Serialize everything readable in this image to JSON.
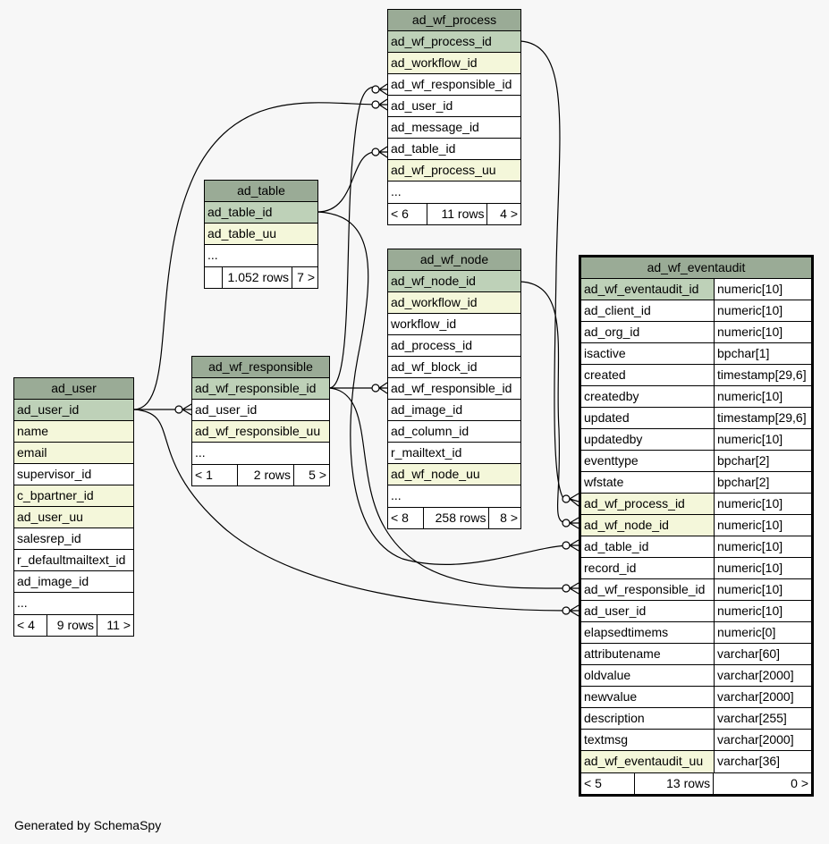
{
  "footer": {
    "generated": "Generated by SchemaSpy"
  },
  "tables": {
    "ad_wf_process": {
      "name": "ad_wf_process",
      "columns": [
        {
          "name": "ad_wf_process_id",
          "kind": "pk"
        },
        {
          "name": "ad_workflow_id",
          "kind": "idx"
        },
        {
          "name": "ad_wf_responsible_id",
          "kind": ""
        },
        {
          "name": "ad_user_id",
          "kind": ""
        },
        {
          "name": "ad_message_id",
          "kind": ""
        },
        {
          "name": "ad_table_id",
          "kind": ""
        },
        {
          "name": "ad_wf_process_uu",
          "kind": "idx"
        },
        {
          "name": "...",
          "kind": ""
        }
      ],
      "footer": [
        "< 6",
        "11 rows",
        "4 >"
      ]
    },
    "ad_table": {
      "name": "ad_table",
      "columns": [
        {
          "name": "ad_table_id",
          "kind": "pk"
        },
        {
          "name": "ad_table_uu",
          "kind": "idx"
        },
        {
          "name": "...",
          "kind": ""
        }
      ],
      "footer": [
        "",
        "1.052 rows",
        "7 >"
      ]
    },
    "ad_wf_node": {
      "name": "ad_wf_node",
      "columns": [
        {
          "name": "ad_wf_node_id",
          "kind": "pk"
        },
        {
          "name": "ad_workflow_id",
          "kind": "idx"
        },
        {
          "name": "workflow_id",
          "kind": ""
        },
        {
          "name": "ad_process_id",
          "kind": ""
        },
        {
          "name": "ad_wf_block_id",
          "kind": ""
        },
        {
          "name": "ad_wf_responsible_id",
          "kind": ""
        },
        {
          "name": "ad_image_id",
          "kind": ""
        },
        {
          "name": "ad_column_id",
          "kind": ""
        },
        {
          "name": "r_mailtext_id",
          "kind": ""
        },
        {
          "name": "ad_wf_node_uu",
          "kind": "idx"
        },
        {
          "name": "...",
          "kind": ""
        }
      ],
      "footer": [
        "< 8",
        "258 rows",
        "8 >"
      ]
    },
    "ad_wf_responsible": {
      "name": "ad_wf_responsible",
      "columns": [
        {
          "name": "ad_wf_responsible_id",
          "kind": "pk"
        },
        {
          "name": "ad_user_id",
          "kind": ""
        },
        {
          "name": "ad_wf_responsible_uu",
          "kind": "idx"
        },
        {
          "name": "...",
          "kind": ""
        }
      ],
      "footer": [
        "< 1",
        "2 rows",
        "5 >"
      ]
    },
    "ad_user": {
      "name": "ad_user",
      "columns": [
        {
          "name": "ad_user_id",
          "kind": "pk"
        },
        {
          "name": "name",
          "kind": "idx"
        },
        {
          "name": "email",
          "kind": "idx"
        },
        {
          "name": "supervisor_id",
          "kind": ""
        },
        {
          "name": "c_bpartner_id",
          "kind": "idx"
        },
        {
          "name": "ad_user_uu",
          "kind": "idx"
        },
        {
          "name": "salesrep_id",
          "kind": ""
        },
        {
          "name": "r_defaultmailtext_id",
          "kind": ""
        },
        {
          "name": "ad_image_id",
          "kind": ""
        },
        {
          "name": "...",
          "kind": ""
        }
      ],
      "footer": [
        "< 4",
        "9 rows",
        "11 >"
      ]
    },
    "ad_wf_eventaudit": {
      "name": "ad_wf_eventaudit",
      "columns": [
        {
          "name": "ad_wf_eventaudit_id",
          "type": "numeric[10]",
          "kind": "pk"
        },
        {
          "name": "ad_client_id",
          "type": "numeric[10]",
          "kind": ""
        },
        {
          "name": "ad_org_id",
          "type": "numeric[10]",
          "kind": ""
        },
        {
          "name": "isactive",
          "type": "bpchar[1]",
          "kind": ""
        },
        {
          "name": "created",
          "type": "timestamp[29,6]",
          "kind": ""
        },
        {
          "name": "createdby",
          "type": "numeric[10]",
          "kind": ""
        },
        {
          "name": "updated",
          "type": "timestamp[29,6]",
          "kind": ""
        },
        {
          "name": "updatedby",
          "type": "numeric[10]",
          "kind": ""
        },
        {
          "name": "eventtype",
          "type": "bpchar[2]",
          "kind": ""
        },
        {
          "name": "wfstate",
          "type": "bpchar[2]",
          "kind": ""
        },
        {
          "name": "ad_wf_process_id",
          "type": "numeric[10]",
          "kind": "idx"
        },
        {
          "name": "ad_wf_node_id",
          "type": "numeric[10]",
          "kind": "idx"
        },
        {
          "name": "ad_table_id",
          "type": "numeric[10]",
          "kind": ""
        },
        {
          "name": "record_id",
          "type": "numeric[10]",
          "kind": ""
        },
        {
          "name": "ad_wf_responsible_id",
          "type": "numeric[10]",
          "kind": ""
        },
        {
          "name": "ad_user_id",
          "type": "numeric[10]",
          "kind": ""
        },
        {
          "name": "elapsedtimems",
          "type": "numeric[0]",
          "kind": ""
        },
        {
          "name": "attributename",
          "type": "varchar[60]",
          "kind": ""
        },
        {
          "name": "oldvalue",
          "type": "varchar[2000]",
          "kind": ""
        },
        {
          "name": "newvalue",
          "type": "varchar[2000]",
          "kind": ""
        },
        {
          "name": "description",
          "type": "varchar[255]",
          "kind": ""
        },
        {
          "name": "textmsg",
          "type": "varchar[2000]",
          "kind": ""
        },
        {
          "name": "ad_wf_eventaudit_uu",
          "type": "varchar[36]",
          "kind": "idx"
        }
      ],
      "footer": [
        "< 5",
        "13 rows",
        "0 >"
      ]
    }
  }
}
